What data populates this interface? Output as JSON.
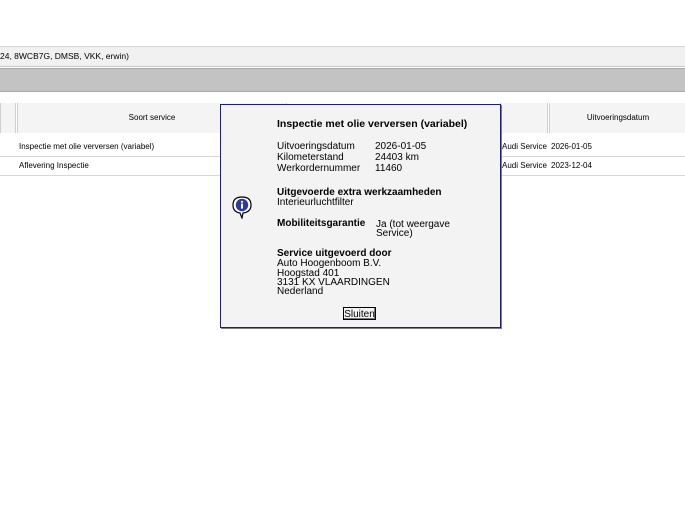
{
  "infobar": {
    "text": "24, 8WCB7G, DMSB, VKK, erwin)"
  },
  "table": {
    "headers": {
      "service_type": "Soort service",
      "date": "Uitvoeringsdatum"
    },
    "rows": [
      {
        "service_type": "Inspectie met olie verversen (variabel)",
        "dealer": "Audi Service",
        "date": "2026-01-05"
      },
      {
        "service_type": "Aflevering Inspectie",
        "dealer": "Audi Service",
        "date": "2023-12-04"
      }
    ]
  },
  "dialog": {
    "title": "Inspectie met olie verversen (variabel)",
    "fields": [
      {
        "label": "Uitvoeringsdatum",
        "value": "2026-01-05"
      },
      {
        "label": "Kilometerstand",
        "value": "24403 km"
      },
      {
        "label": "Werkordernummer",
        "value": "11460"
      }
    ],
    "extra_heading": "Uitgevoerde extra werkzaamheden",
    "extra_item": "Interieurluchtfilter",
    "mobility_label": "Mobiliteitsgarantie",
    "mobility_value_line1": "Ja (tot weergave",
    "mobility_value_line2": "Service)",
    "performed_by_heading": "Service uitgevoerd door",
    "address": [
      "Auto Hoogenboom B.V.",
      "Hoogstad 401",
      "3131 KX VLAARDINGEN",
      "Nederland"
    ],
    "close_label": "Sluiten",
    "icon": "info-icon",
    "accent_color": "#1f1f6f"
  }
}
